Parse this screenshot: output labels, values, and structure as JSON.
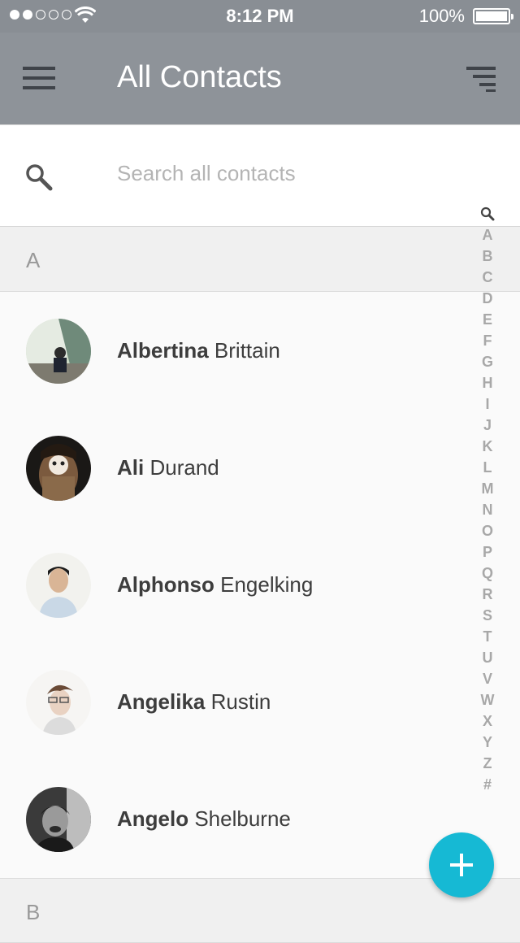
{
  "status_bar": {
    "time": "8:12 PM",
    "battery": "100%"
  },
  "header": {
    "title": "All Contacts"
  },
  "search": {
    "placeholder": "Search all contacts"
  },
  "sections": [
    {
      "letter": "A"
    },
    {
      "letter": "B"
    }
  ],
  "contacts": [
    {
      "first": "Albertina",
      "last": "Brittain"
    },
    {
      "first": "Ali",
      "last": "Durand"
    },
    {
      "first": "Alphonso",
      "last": "Engelking"
    },
    {
      "first": "Angelika",
      "last": "Rustin"
    },
    {
      "first": "Angelo",
      "last": "Shelburne"
    }
  ],
  "index_letters": [
    "A",
    "B",
    "C",
    "D",
    "E",
    "F",
    "G",
    "H",
    "I",
    "J",
    "K",
    "L",
    "M",
    "N",
    "O",
    "P",
    "Q",
    "R",
    "S",
    "T",
    "U",
    "V",
    "W",
    "X",
    "Y",
    "Z",
    "#"
  ],
  "icons": {
    "menu": "hamburger-icon",
    "sort": "sort-icon",
    "search": "search-icon",
    "add": "plus-icon"
  },
  "colors": {
    "accent": "#16b9d4",
    "header": "#8e9399",
    "status": "#898e94"
  }
}
